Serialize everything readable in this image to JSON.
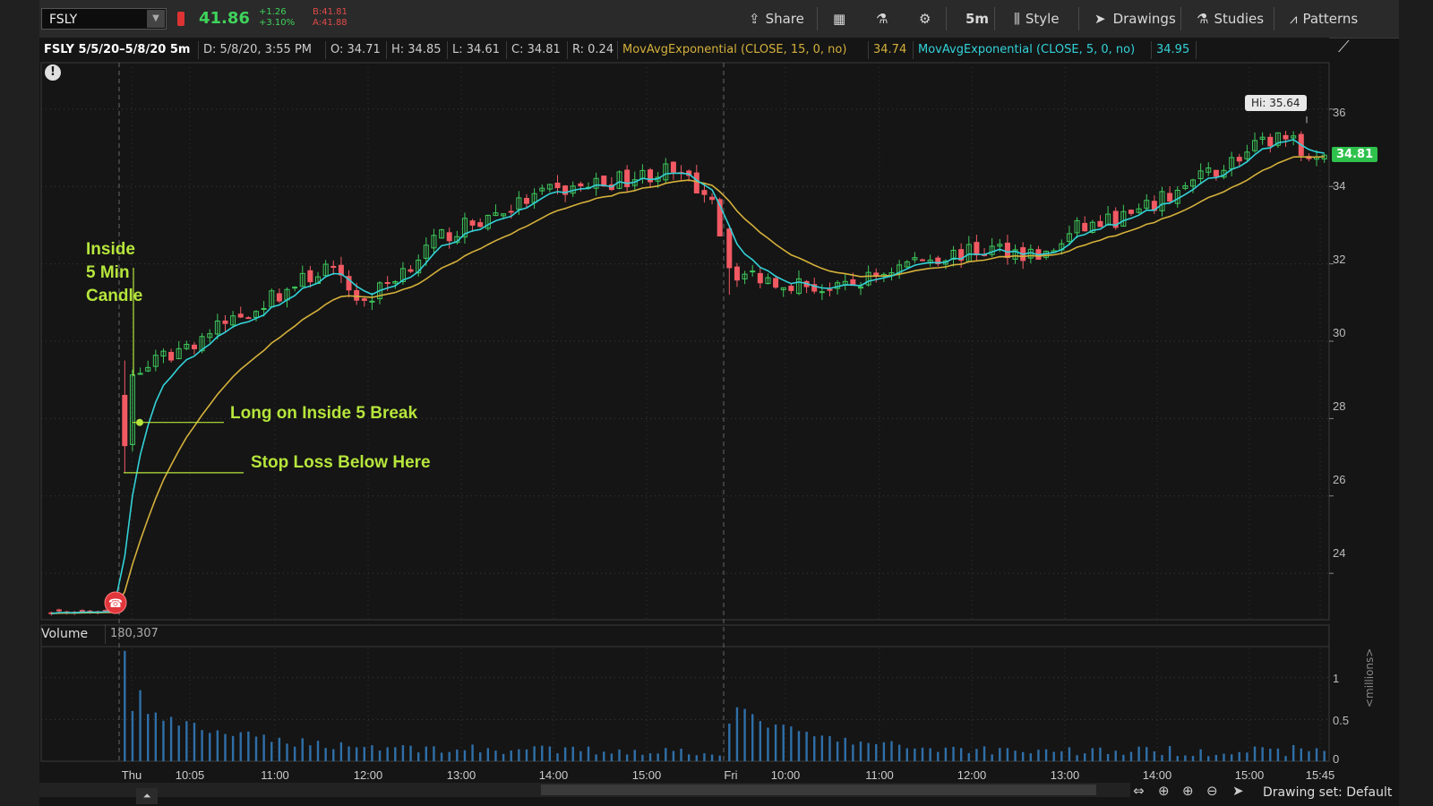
{
  "toolbar": {
    "symbol": "FSLY",
    "last_price": "41.86",
    "change": "+1.26",
    "change_pct": "+3.10%",
    "bid": "B:41.81",
    "ask": "A:41.88",
    "share_label": "Share",
    "timeframe": "5m",
    "style_label": "Style",
    "drawings_label": "Drawings",
    "studies_label": "Studies",
    "patterns_label": "Patterns"
  },
  "infobar": {
    "range": "FSLY 5/5/20–5/8/20 5m",
    "date": "D: 5/8/20, 3:55 PM",
    "open": "O: 34.71",
    "high": "H: 34.85",
    "low": "L: 34.61",
    "close": "C: 34.81",
    "range_val": "R: 0.24",
    "ema15_label": "MovAvgExponential (CLOSE, 15, 0, no)",
    "ema15_value": "34.74",
    "ema5_label": "MovAvgExponential (CLOSE, 5, 0, no)",
    "ema5_value": "34.95"
  },
  "chart": {
    "hi_label": "Hi: 35.64",
    "last_price_tag": "34.81",
    "annotations": {
      "inside": "Inside\n5 Min\nCandle",
      "long": "Long on Inside 5 Break",
      "stop": "Stop Loss Below Here"
    },
    "y_ticks": [
      "36",
      "34",
      "32",
      "30",
      "28",
      "26",
      "24"
    ],
    "x_ticks": [
      "Thu",
      "10:05",
      "11:00",
      "12:00",
      "13:00",
      "14:00",
      "15:00",
      "Fri",
      "10:00",
      "11:00",
      "12:00",
      "13:00",
      "14:00",
      "15:00",
      "15:45"
    ]
  },
  "volume": {
    "label": "Volume",
    "value": "180,307",
    "y_ticks": [
      "1",
      "0.5",
      "0"
    ],
    "units": "<millions>"
  },
  "footer": {
    "drawing_set": "Drawing set: Default"
  },
  "colors": {
    "up": "#3ec95c",
    "down": "#f25a63",
    "ema5": "#32d2d8",
    "ema15": "#d4b03b",
    "annotation": "#b6e63c",
    "volume": "#2f6fa8"
  },
  "chart_data": {
    "type": "candlestick",
    "symbol": "FSLY",
    "ylim": [
      22.8,
      37.2
    ],
    "days": [
      "Thu",
      "Fri"
    ],
    "key_points": [
      {
        "x": "Wed close",
        "y": 23.0
      },
      {
        "x": "Thu 09:35",
        "y": 29.0
      },
      {
        "x": "Thu 11:45",
        "y": 31.9
      },
      {
        "x": "Thu 12:10",
        "y": 31.0
      },
      {
        "x": "Thu 13:00",
        "y": 32.7
      },
      {
        "x": "Thu 14:05",
        "y": 33.8
      },
      {
        "x": "Thu 15:25",
        "y": 34.4
      },
      {
        "x": "Thu 15:55",
        "y": 33.8
      },
      {
        "x": "Fri 09:35",
        "y": 31.8
      },
      {
        "x": "Fri 10:45",
        "y": 31.3
      },
      {
        "x": "Fri 11:35",
        "y": 32.1
      },
      {
        "x": "Fri 12:30",
        "y": 32.4
      },
      {
        "x": "Fri 13:00",
        "y": 32.2
      },
      {
        "x": "Fri 13:20",
        "y": 32.9
      },
      {
        "x": "Fri 14:00",
        "y": 33.3
      },
      {
        "x": "Fri 14:30",
        "y": 34.0
      },
      {
        "x": "Fri 15:30",
        "y": 35.3
      },
      {
        "x": "Fri 15:55",
        "y": 34.81
      }
    ],
    "annotations": {
      "long_entry": 27.9,
      "stop_loss": 26.6,
      "high": 35.64
    },
    "volume_ylim": [
      0,
      1.35
    ]
  }
}
